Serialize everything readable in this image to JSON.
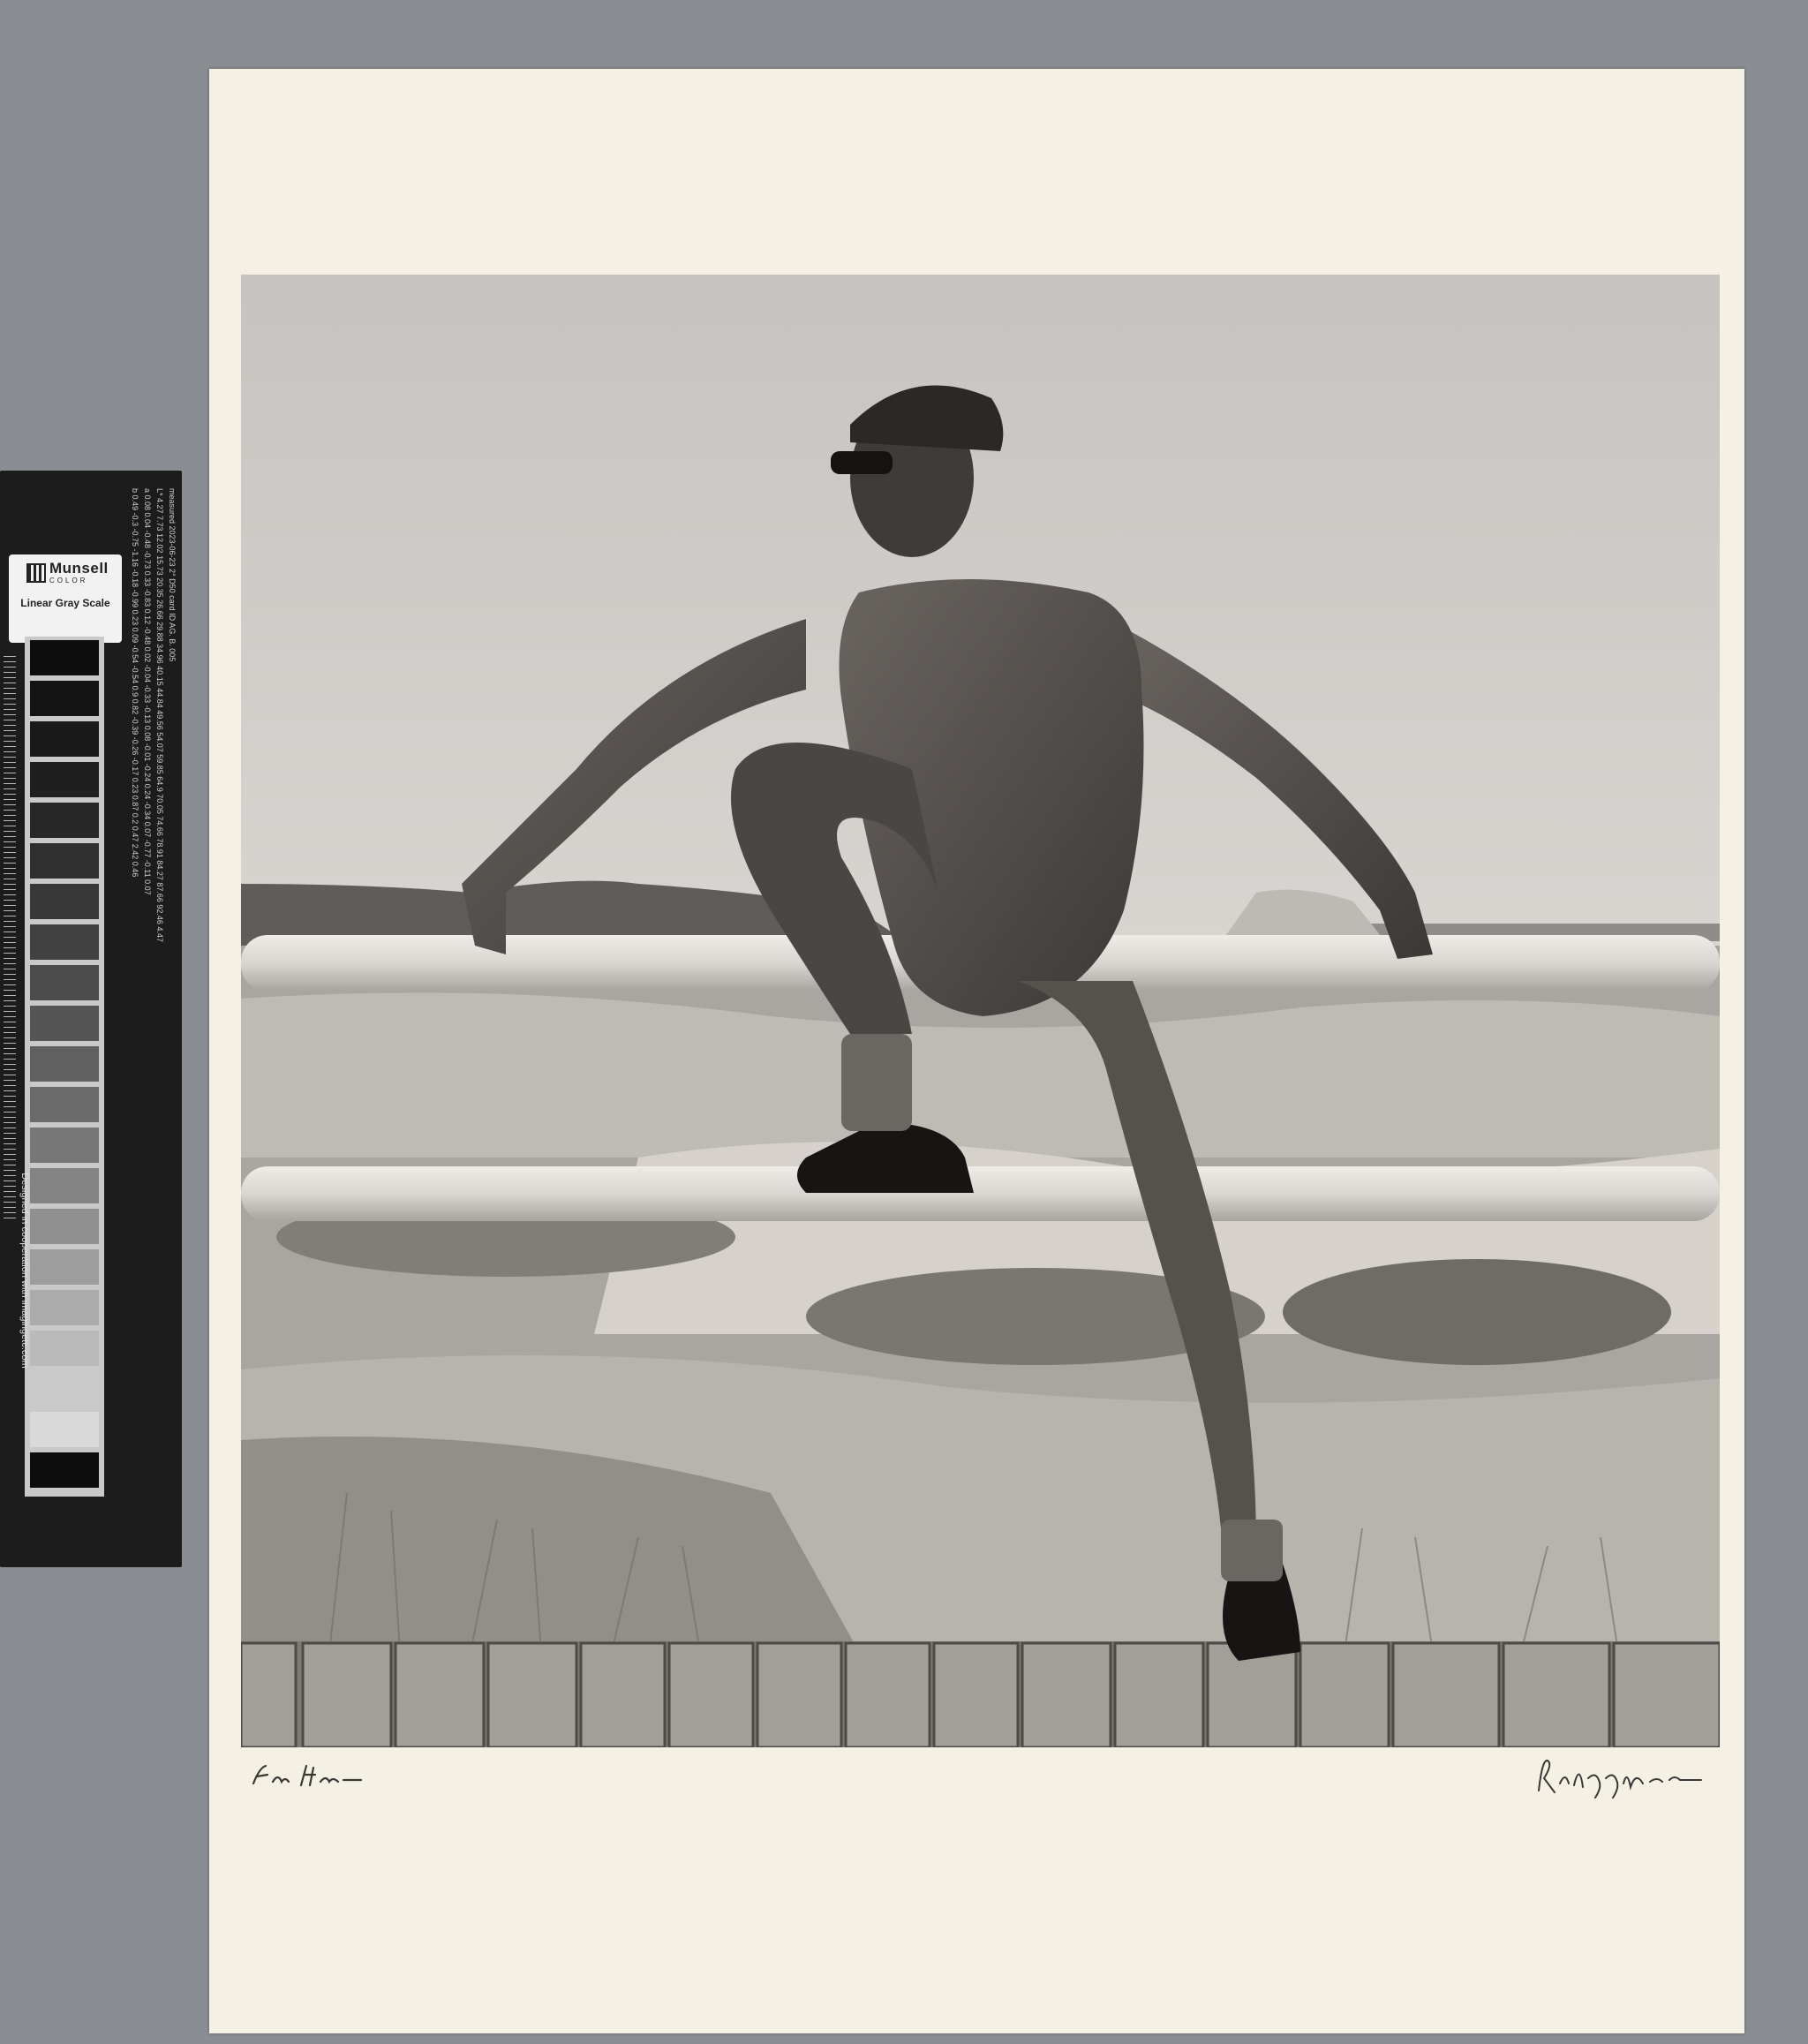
{
  "gray_scale_card": {
    "brand": "Munsell",
    "brand_sub": "COLOR",
    "caption": "Linear Gray Scale",
    "credit": "Designed in cooperation with imagingetc.com",
    "card_id_label": "card ID",
    "card_id": "AG. B. 005",
    "measured_label": "measured",
    "measured": "2023-06-23",
    "illuminant": "2° D50",
    "columns": [
      "L*",
      "a",
      "b"
    ],
    "steps": [
      {
        "step": "G",
        "L": "4.27",
        "a": "0.08",
        "b": "0.49"
      },
      {
        "step": "5",
        "L": "7.73",
        "a": "0.04",
        "b": "-0.3"
      },
      {
        "step": "10",
        "L": "12.02",
        "a": "-0.48",
        "b": "-0.75"
      },
      {
        "step": "15",
        "L": "15.73",
        "a": "-0.73",
        "b": "-1.16"
      },
      {
        "step": "20",
        "L": "20.35",
        "a": "0.33",
        "b": "-0.18"
      },
      {
        "step": "25",
        "L": "26.66",
        "a": "-0.83",
        "b": "-0.99"
      },
      {
        "step": "30",
        "L": "29.88",
        "a": "0.12",
        "b": "0.23"
      },
      {
        "step": "35",
        "L": "34.96",
        "a": "-0.48",
        "b": "0.09"
      },
      {
        "step": "40",
        "L": "40.15",
        "a": "0.02",
        "b": "-0.54"
      },
      {
        "step": "45",
        "L": "44.84",
        "a": "-0.04",
        "b": "-0.54"
      },
      {
        "step": "50",
        "L": "49.56",
        "a": "-0.33",
        "b": "0.9"
      },
      {
        "step": "55",
        "L": "54.07",
        "a": "-0.13",
        "b": "0.82"
      },
      {
        "step": "60",
        "L": "59.85",
        "a": "0.08",
        "b": "-0.39"
      },
      {
        "step": "65",
        "L": "64.9",
        "a": "-0.01",
        "b": "-0.26"
      },
      {
        "step": "70",
        "L": "70.05",
        "a": "-0.24",
        "b": "-0.17"
      },
      {
        "step": "75",
        "L": "74.66",
        "a": "0.24",
        "b": "0.23"
      },
      {
        "step": "80",
        "L": "78.91",
        "a": "-0.34",
        "b": "0.87"
      },
      {
        "step": "85",
        "L": "84.27",
        "a": "0.07",
        "b": "0.2"
      },
      {
        "step": "90",
        "L": "87.66",
        "a": "-0.77",
        "b": "0.47"
      },
      {
        "step": "95",
        "L": "92.46",
        "a": "-0.11",
        "b": "2.42"
      },
      {
        "step": "G",
        "L": "4.47",
        "a": "0.07",
        "b": "0.46"
      }
    ],
    "ruler_unit": "mm",
    "swatch_colors": [
      "#0d0d0d",
      "#131313",
      "#191919",
      "#1f1f1f",
      "#272727",
      "#2f2f2f",
      "#383838",
      "#414141",
      "#4b4b4b",
      "#555555",
      "#606060",
      "#6b6b6b",
      "#777777",
      "#838383",
      "#909090",
      "#9d9d9d",
      "#ababab",
      "#bababa",
      "#c9c9c9",
      "#d9d9d9",
      "#0d0d0d"
    ]
  },
  "print": {
    "dedication": "For Home —",
    "signature": "Robert Mapplethorpe '82"
  }
}
